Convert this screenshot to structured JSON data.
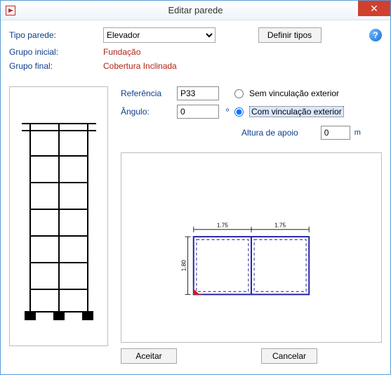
{
  "window": {
    "title": "Editar parede",
    "close_glyph": "✕"
  },
  "top": {
    "tipo_label": "Tipo parede:",
    "tipo_value": "Elevador",
    "grupo_inicial_label": "Grupo inicial:",
    "grupo_inicial_value": "Fundação",
    "grupo_final_label": "Grupo final:",
    "grupo_final_value": "Cobertura Inclinada",
    "definir_tipos": "Definir tipos",
    "help_glyph": "?"
  },
  "params": {
    "referencia_label": "Referência",
    "referencia_value": "P33",
    "angulo_label": "Ângulo:",
    "angulo_value": "0",
    "angulo_unit": "º",
    "radio_sem": "Sem vinculação exterior",
    "radio_com": "Com vinculação exterior",
    "vinc_selected": "com",
    "altura_label": "Altura de apoio",
    "altura_value": "0",
    "altura_unit": "m"
  },
  "preview": {
    "dim_left": "1.75",
    "dim_right": "1.75",
    "dim_height": "1.80"
  },
  "buttons": {
    "accept": "Aceitar",
    "cancel": "Cancelar"
  }
}
